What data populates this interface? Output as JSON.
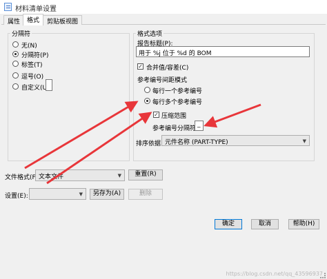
{
  "window": {
    "title": "材料清单设置"
  },
  "tabs": [
    {
      "label": "属性",
      "active": false
    },
    {
      "label": "格式",
      "active": true
    },
    {
      "label": "剪贴板视图",
      "active": false
    }
  ],
  "separator_group": {
    "label": "分隔符",
    "options": [
      {
        "label": "无(N)",
        "selected": false
      },
      {
        "label": "分隔符(P)",
        "selected": true
      },
      {
        "label": "标签(T)",
        "selected": false
      },
      {
        "label": "逗号(O)",
        "selected": false
      },
      {
        "label": "自定义(U)",
        "selected": false,
        "value": ""
      }
    ]
  },
  "format_group": {
    "label": "格式选项",
    "report_title_label": "报告标题(P):",
    "report_title_value": "用于 %j 位于 %d 的 BOM",
    "merge_values_label": "合并值/容差(C)",
    "merge_values_checked": true,
    "ref_spacing_label": "参考编号间距模式",
    "per_row_single_label": "每行一个参考编号",
    "per_row_single_selected": false,
    "per_row_multiple_label": "每行多个参考编号",
    "per_row_multiple_selected": true,
    "compress_range_label": "压缩范围",
    "compress_range_checked": true,
    "ref_separator_label": "参考编号分隔符",
    "ref_separator_value": "_",
    "sort_label": "排序依据",
    "sort_value": "元件名称 (PART-TYPE)"
  },
  "file_format": {
    "label": "文件格式(F):",
    "value": "文本文件",
    "reset_button": "重置(R)"
  },
  "settings": {
    "label": "设置(E):",
    "value": "",
    "save_as_button": "另存为(A)",
    "delete_button": "删除"
  },
  "footer": {
    "ok_button": "确定",
    "cancel_button": "取消",
    "help_button": "帮助(H)",
    "watermark": "https://blog.csdn.net/qq_43596937"
  },
  "colors": {
    "arrow": "#e8363a",
    "accent": "#0078d7"
  }
}
